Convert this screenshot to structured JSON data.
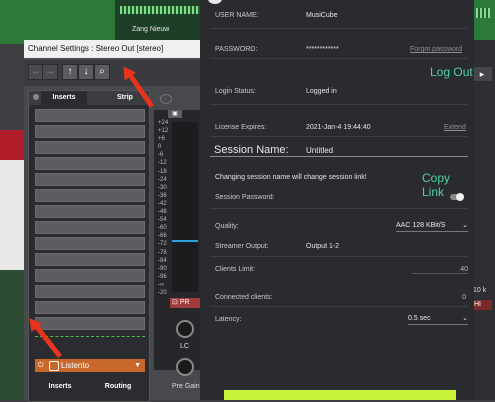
{
  "background": {
    "track_label": "Zang Nieuw"
  },
  "channel_window": {
    "title": "Channel Settings : Stereo Out [stereo]",
    "toolbar": {
      "back_icon": "left-arrow-icon",
      "forward_icon": "right-arrow-icon",
      "up_icon": "up-arrow-icon",
      "down_icon": "down-arrow-icon",
      "search_icon": "search-icon"
    },
    "top_tabs": [
      "Inserts",
      "Strip"
    ],
    "insert_plugin": "Listento",
    "bottom_tabs": [
      "Inserts",
      "Routing"
    ],
    "meter_ticks": [
      "+24",
      "+12",
      "+6",
      "0",
      "-6",
      "-12",
      "-18",
      "-24",
      "-30",
      "-36",
      "-42",
      "-48",
      "-54",
      "-60",
      "-66",
      "-72",
      "-78",
      "-84",
      "-90",
      "-96",
      "-∞",
      "-20"
    ],
    "pre_label": "PR",
    "knob_labels": [
      "LC",
      "Pre Gain"
    ]
  },
  "right_strip": {
    "value_10k": "10 k",
    "hi_label": "HI"
  },
  "musicube": {
    "user_name_label": "USER NAME:",
    "user_name_value": "MusiCube",
    "password_label": "PASSWORD:",
    "password_value": "************",
    "forgot_password": "Forgot password",
    "logout": "Log Out",
    "login_status_label": "Login Status:",
    "login_status_value": "Logged in",
    "license_label": "License Expires:",
    "license_value": "2021-Jan-4 19:44:40",
    "extend": "Extend",
    "session_name_label": "Session Name:",
    "session_name_value": "Untitled",
    "session_change_note": "Changing session name will change session link!",
    "copy_link": "Copy Link",
    "session_password_label": "Session Password:",
    "quality_label": "Quality:",
    "quality_value": "AAC 128 KBit/S",
    "streamer_output_label": "Streamer Output:",
    "streamer_output_value": "Output 1-2",
    "clients_limit_label": "Clients Limit:",
    "clients_limit_value": "40",
    "connected_clients_label": "Connected clients:",
    "connected_clients_value": "0",
    "latency_label": "Latency:",
    "latency_value": "0.5 sec",
    "accent_color": "#4fd0a3",
    "button_color": "#c8f23a"
  }
}
